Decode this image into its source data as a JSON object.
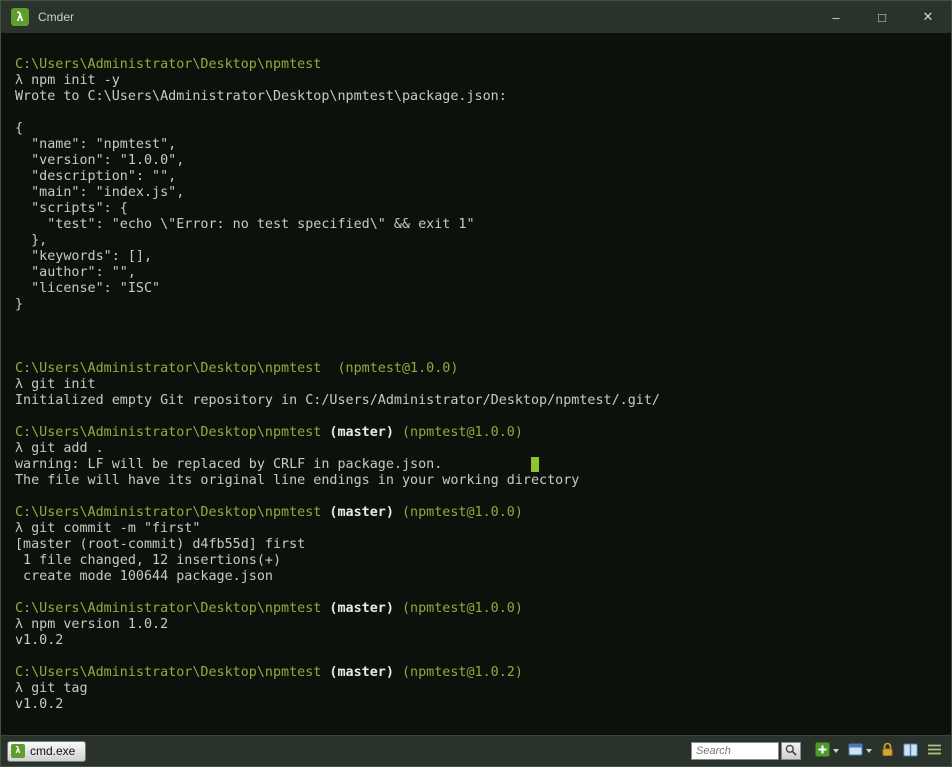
{
  "colors": {
    "terminal-bg": "#0c110c",
    "chrome-bg": "#2a332b",
    "border": "#454f45",
    "path": "#9aa63c",
    "text": "#c9c9c9",
    "bright": "#e9e9e9",
    "lambda": "#c0c0c0",
    "cursor": "#8fc32c",
    "brand-green": "#5f9e2e",
    "lock-yellow": "#d9a62e",
    "icon-blue": "#4a7ab0"
  },
  "window": {
    "title": "Cmder",
    "icon_glyph": "λ",
    "controls": {
      "minimize": "–",
      "maximize": "□",
      "close": "✕"
    }
  },
  "terminal": {
    "lines": [
      {
        "segments": [
          {
            "t": "C:\\Users\\Administrator\\Desktop\\npmtest",
            "c": "path"
          }
        ]
      },
      {
        "segments": [
          {
            "t": "λ",
            "c": "lambda"
          },
          {
            "t": " npm init -y",
            "c": "text"
          }
        ]
      },
      {
        "segments": [
          {
            "t": "Wrote to C:\\Users\\Administrator\\Desktop\\npmtest\\package.json:",
            "c": "text"
          }
        ]
      },
      {
        "segments": []
      },
      {
        "segments": [
          {
            "t": "{",
            "c": "text"
          }
        ]
      },
      {
        "segments": [
          {
            "t": "  \"name\": \"npmtest\",",
            "c": "text"
          }
        ]
      },
      {
        "segments": [
          {
            "t": "  \"version\": \"1.0.0\",",
            "c": "text"
          }
        ]
      },
      {
        "segments": [
          {
            "t": "  \"description\": \"\",",
            "c": "text"
          }
        ]
      },
      {
        "segments": [
          {
            "t": "  \"main\": \"index.js\",",
            "c": "text"
          }
        ]
      },
      {
        "segments": [
          {
            "t": "  \"scripts\": {",
            "c": "text"
          }
        ]
      },
      {
        "segments": [
          {
            "t": "    \"test\": \"echo \\\"Error: no test specified\\\" && exit 1\"",
            "c": "text"
          }
        ]
      },
      {
        "segments": [
          {
            "t": "  },",
            "c": "text"
          }
        ]
      },
      {
        "segments": [
          {
            "t": "  \"keywords\": [],",
            "c": "text"
          }
        ]
      },
      {
        "segments": [
          {
            "t": "  \"author\": \"\",",
            "c": "text"
          }
        ]
      },
      {
        "segments": [
          {
            "t": "  \"license\": \"ISC\"",
            "c": "text"
          }
        ]
      },
      {
        "segments": [
          {
            "t": "}",
            "c": "text"
          }
        ]
      },
      {
        "segments": []
      },
      {
        "segments": []
      },
      {
        "segments": []
      },
      {
        "segments": [
          {
            "t": "C:\\Users\\Administrator\\Desktop\\npmtest",
            "c": "path"
          },
          {
            "t": "  ",
            "c": "text"
          },
          {
            "t": "(npmtest@1.0.0)",
            "c": "ver"
          }
        ]
      },
      {
        "segments": [
          {
            "t": "λ",
            "c": "lambda"
          },
          {
            "t": " git init",
            "c": "text"
          }
        ]
      },
      {
        "segments": [
          {
            "t": "Initialized empty Git repository in C:/Users/Administrator/Desktop/npmtest/.git/",
            "c": "text"
          }
        ]
      },
      {
        "segments": []
      },
      {
        "segments": [
          {
            "t": "C:\\Users\\Administrator\\Desktop\\npmtest",
            "c": "path"
          },
          {
            "t": " ",
            "c": "text"
          },
          {
            "t": "(master)",
            "c": "branch"
          },
          {
            "t": " ",
            "c": "text"
          },
          {
            "t": "(npmtest@1.0.0)",
            "c": "ver"
          }
        ]
      },
      {
        "segments": [
          {
            "t": "λ",
            "c": "lambda"
          },
          {
            "t": " git add .",
            "c": "text"
          }
        ]
      },
      {
        "segments": [
          {
            "t": "warning: LF will be replaced by CRLF in package.json.",
            "c": "text"
          },
          {
            "t": "           ",
            "c": "text"
          },
          {
            "t": " ",
            "c": "cursor"
          }
        ]
      },
      {
        "segments": [
          {
            "t": "The file will have its original line endings in your working directory",
            "c": "text"
          }
        ]
      },
      {
        "segments": []
      },
      {
        "segments": [
          {
            "t": "C:\\Users\\Administrator\\Desktop\\npmtest",
            "c": "path"
          },
          {
            "t": " ",
            "c": "text"
          },
          {
            "t": "(master)",
            "c": "branch"
          },
          {
            "t": " ",
            "c": "text"
          },
          {
            "t": "(npmtest@1.0.0)",
            "c": "ver"
          }
        ]
      },
      {
        "segments": [
          {
            "t": "λ",
            "c": "lambda"
          },
          {
            "t": " git commit -m \"first\"",
            "c": "text"
          }
        ]
      },
      {
        "segments": [
          {
            "t": "[master (root-commit) d4fb55d] first",
            "c": "text"
          }
        ]
      },
      {
        "segments": [
          {
            "t": " 1 file changed, 12 insertions(+)",
            "c": "text"
          }
        ]
      },
      {
        "segments": [
          {
            "t": " create mode 100644 package.json",
            "c": "text"
          }
        ]
      },
      {
        "segments": []
      },
      {
        "segments": [
          {
            "t": "C:\\Users\\Administrator\\Desktop\\npmtest",
            "c": "path"
          },
          {
            "t": " ",
            "c": "text"
          },
          {
            "t": "(master)",
            "c": "branch"
          },
          {
            "t": " ",
            "c": "text"
          },
          {
            "t": "(npmtest@1.0.0)",
            "c": "ver"
          }
        ]
      },
      {
        "segments": [
          {
            "t": "λ",
            "c": "lambda"
          },
          {
            "t": " npm version 1.0.2",
            "c": "text"
          }
        ]
      },
      {
        "segments": [
          {
            "t": "v1.0.2",
            "c": "text"
          }
        ]
      },
      {
        "segments": []
      },
      {
        "segments": [
          {
            "t": "C:\\Users\\Administrator\\Desktop\\npmtest",
            "c": "path"
          },
          {
            "t": " ",
            "c": "text"
          },
          {
            "t": "(master)",
            "c": "branch"
          },
          {
            "t": " ",
            "c": "text"
          },
          {
            "t": "(npmtest@1.0.2)",
            "c": "ver"
          }
        ]
      },
      {
        "segments": [
          {
            "t": "λ",
            "c": "lambda"
          },
          {
            "t": " git tag",
            "c": "text"
          }
        ]
      },
      {
        "segments": [
          {
            "t": "v1.0.2",
            "c": "text"
          }
        ]
      }
    ]
  },
  "statusbar": {
    "tab_label": "cmd.exe",
    "search_placeholder": "Search"
  }
}
